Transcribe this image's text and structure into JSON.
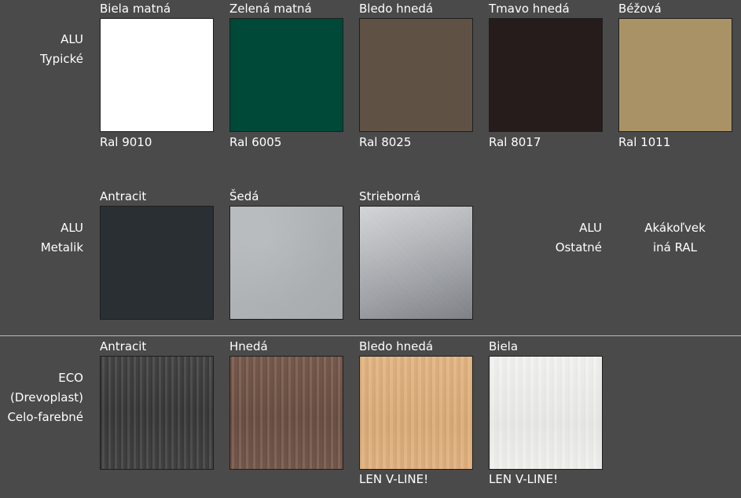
{
  "sections": {
    "alu_typicke": {
      "label_line1": "ALU",
      "label_line2": "Typické",
      "items": [
        {
          "name": "Biela matná",
          "code": "Ral 9010",
          "color": "#ffffff"
        },
        {
          "name": "Zelená matná",
          "code": "Ral 6005",
          "color": "#004837"
        },
        {
          "name": "Bledo hnedá",
          "code": "Ral 8025",
          "color": "#5f5245"
        },
        {
          "name": "Tmavo hnedá",
          "code": "Ral 8017",
          "color": "#251c1b"
        },
        {
          "name": "Béžová",
          "code": "Ral 1011",
          "color": "#a99366"
        }
      ]
    },
    "alu_metalik": {
      "label_line1": "ALU",
      "label_line2": "Metalik",
      "items": [
        {
          "name": "Antracit"
        },
        {
          "name": "Šedá"
        },
        {
          "name": "Strieborná"
        }
      ]
    },
    "alu_ostatne": {
      "label_line1": "ALU",
      "label_line2": "Ostatné",
      "value_line1": "Akákoľvek",
      "value_line2": "iná RAL"
    },
    "eco": {
      "label_line1": "ECO",
      "label_line2": "(Drevoplast)",
      "label_line3": "Celo-farebné",
      "items": [
        {
          "name": "Antracit",
          "note": ""
        },
        {
          "name": "Hnedá",
          "note": ""
        },
        {
          "name": "Bledo hnedá",
          "note": "LEN V-LINE!"
        },
        {
          "name": "Biela",
          "note": "LEN V-LINE!"
        }
      ]
    }
  }
}
